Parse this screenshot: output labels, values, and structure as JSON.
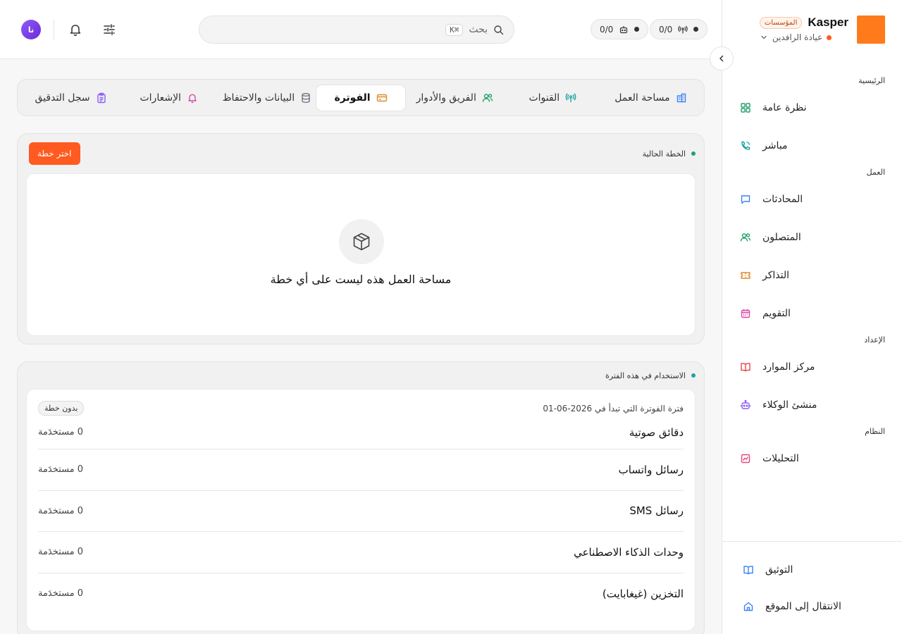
{
  "brand": {
    "name": "Kasper",
    "badge": "المؤسسات",
    "workspace": "عيادة الرافدين",
    "logo_color": "#ff7a1a"
  },
  "topbar": {
    "counter_1": "0/0",
    "counter_2": "0/0",
    "search_placeholder": "بحث",
    "search_shortcut": "⌘K",
    "avatar_initials": "نا"
  },
  "sidebar": {
    "sections": [
      {
        "label": "الرئيسية",
        "items": [
          {
            "label": "نظرة عامة",
            "icon": "grid-icon",
            "color": "#22a06b"
          },
          {
            "label": "مباشر",
            "icon": "phone-icon",
            "color": "#1aa3a3"
          }
        ]
      },
      {
        "label": "العمل",
        "items": [
          {
            "label": "المحادثات",
            "icon": "chat-icon",
            "color": "#3b82f6"
          },
          {
            "label": "المتصلون",
            "icon": "users-icon",
            "color": "#22a06b"
          },
          {
            "label": "التذاكر",
            "icon": "ticket-icon",
            "color": "#e0892b"
          },
          {
            "label": "التقويم",
            "icon": "calendar-icon",
            "color": "#d946a8"
          }
        ]
      },
      {
        "label": "الإعداد",
        "items": [
          {
            "label": "مركز الموارد",
            "icon": "book-icon",
            "color": "#e5484d"
          },
          {
            "label": "منشئ الوكلاء",
            "icon": "bot-icon",
            "color": "#8b5cf6"
          }
        ]
      },
      {
        "label": "النظام",
        "items": [
          {
            "label": "التحليلات",
            "icon": "chart-icon",
            "color": "#e5487d"
          }
        ]
      }
    ],
    "footer": [
      {
        "label": "التوثيق",
        "icon": "docs-icon",
        "color": "#3b82f6"
      },
      {
        "label": "الانتقال إلى الموقع",
        "icon": "home-icon",
        "color": "#3b82f6"
      }
    ]
  },
  "tabs": [
    {
      "label": "مساحة العمل",
      "icon": "building-icon",
      "color": "#3b82f6",
      "active": false
    },
    {
      "label": "القنوات",
      "icon": "antenna-icon",
      "color": "#1aa3a3",
      "active": false
    },
    {
      "label": "الفريق والأدوار",
      "icon": "users-icon",
      "color": "#22a06b",
      "active": false
    },
    {
      "label": "الفوترة",
      "icon": "card-icon",
      "color": "#e0892b",
      "active": true
    },
    {
      "label": "البيانات والاحتفاظ",
      "icon": "database-icon",
      "color": "#6b7280",
      "active": false
    },
    {
      "label": "الإشعارات",
      "icon": "bell-icon",
      "color": "#d946a8",
      "active": false
    },
    {
      "label": "سجل التدقيق",
      "icon": "clipboard-icon",
      "color": "#8b5cf6",
      "active": false
    }
  ],
  "plan": {
    "title": "الخطة الحالية",
    "choose_button": "اختر خطة",
    "empty_text": "مساحة العمل هذه ليست على أي خطة"
  },
  "usage": {
    "title": "الاستخدام في هذه الفترة",
    "period": "فترة الفوترة التي تبدأ في 2026-06-01",
    "badge": "بدون خطة",
    "rows": [
      {
        "name": "دقائق صوتية",
        "value": "0 مستخدَمة"
      },
      {
        "name": "رسائل واتساب",
        "value": "0 مستخدَمة"
      },
      {
        "name": "رسائل SMS",
        "value": "0 مستخدَمة"
      },
      {
        "name": "وحدات الذكاء الاصطناعي",
        "value": "0 مستخدَمة"
      },
      {
        "name": "التخزين (غيغابايت)",
        "value": "0 مستخدَمة"
      }
    ]
  },
  "colors": {
    "accent": "#ff5a1f",
    "status_green": "#22a06b"
  }
}
